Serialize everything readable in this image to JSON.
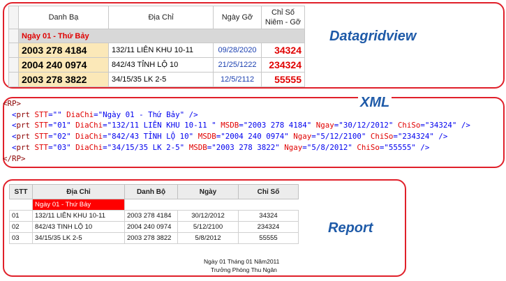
{
  "titles": {
    "datagrid": "Datagridview",
    "xml": "XML",
    "report": "Report"
  },
  "datagrid": {
    "headers": {
      "danhba": "Danh Bạ",
      "diachi": "Địa Chỉ",
      "ngay": "Ngày Gỡ",
      "chiso_l1": "Chỉ Số",
      "chiso_l2": "Niêm - Gỡ"
    },
    "group": "Ngày 01 - Thứ Bảy",
    "rows": [
      {
        "danhba": "2003 278 4184",
        "diachi": "132/11 LIÊN KHU 10-11",
        "ngay": "09/28/2020",
        "chiso": "34324"
      },
      {
        "danhba": "2004 240 0974",
        "diachi": "842/43 TỈNH LỘ 10",
        "ngay": "21/25/1222",
        "chiso": "234324"
      },
      {
        "danhba": "2003 278 3822",
        "diachi": "34/15/35 LK 2-5",
        "ngay": "12/5/2112",
        "chiso": "55555"
      }
    ]
  },
  "xml": {
    "root_open": "<RP>",
    "root_close": "</RP>",
    "lines": [
      {
        "stt": "",
        "diachi": "Ngày 01 - Thứ Bảy"
      },
      {
        "stt": "01",
        "diachi": "132/11 LIÊN KHU 10-11 ",
        "msdb": "2003 278 4184",
        "ngay": "30/12/2012",
        "chiso": "34324"
      },
      {
        "stt": "02",
        "diachi": "842/43 TỈNH LỘ 10",
        "msdb": "2004 240 0974",
        "ngay": "5/12/2100",
        "chiso": "234324"
      },
      {
        "stt": "03",
        "diachi": "34/15/35 LK 2-5",
        "msdb": "2003 278 3822",
        "ngay": "5/8/2012",
        "chiso": "55555"
      }
    ]
  },
  "report": {
    "headers": {
      "stt": "STT",
      "diachi": "Địa Chỉ",
      "danhbo": "Danh Bộ",
      "ngay": "Ngày",
      "chiso": "Chỉ Số"
    },
    "group": "Ngày 01 - Thứ Bảy",
    "rows": [
      {
        "stt": "01",
        "diachi": "132/11 LIÊN KHU 10-11",
        "danhbo": "2003 278 4184",
        "ngay": "30/12/2012",
        "chiso": "34324"
      },
      {
        "stt": "02",
        "diachi": "842/43 TINH LỘ 10",
        "danhbo": "2004 240 0974",
        "ngay": "5/12/2100",
        "chiso": "234324"
      },
      {
        "stt": "03",
        "diachi": "34/15/35 LK 2-5",
        "danhbo": "2003 278 3822",
        "ngay": "5/8/2012",
        "chiso": "55555"
      }
    ],
    "footer_date": "Ngày 01 Tháng 01 Năm2011",
    "footer_sign": "Trưởng Phòng Thu Ngân"
  }
}
